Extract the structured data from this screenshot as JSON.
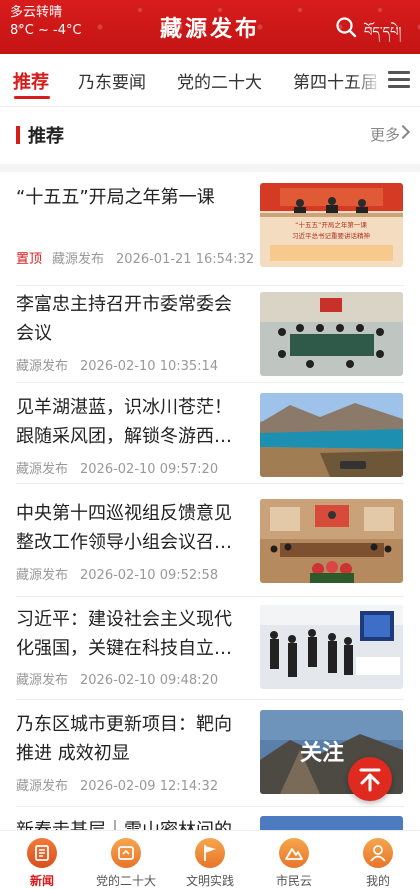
{
  "header": {
    "weather_condition": "多云转晴",
    "temperature_range": "8°C ~ -4°C",
    "app_title": "藏源发布",
    "tibetan_label": "བོད་དཔེ།",
    "search_icon": "search-icon"
  },
  "tabs": [
    {
      "label": "推荐",
      "active": true
    },
    {
      "label": "乃东要闻",
      "active": false
    },
    {
      "label": "党的二十大",
      "active": false
    },
    {
      "label": "第四十五届",
      "active": false
    }
  ],
  "section": {
    "title": "推荐",
    "more_label": "更多"
  },
  "news": [
    {
      "title": "“十五五”开局之年第一课",
      "pinned_label": "置顶",
      "source": "藏源发布",
      "time": "2026-01-21 16:54:32"
    },
    {
      "title": "李富忠主持召开市委常委会会议",
      "pinned_label": "",
      "source": "藏源发布",
      "time": "2026-02-10 10:35:14"
    },
    {
      "title": "见羊湖湛蓝，识冰川苍茫！跟随采风团，解锁冬游西…",
      "pinned_label": "",
      "source": "藏源发布",
      "time": "2026-02-10 09:57:20"
    },
    {
      "title": "中央第十四巡视组反馈意见整改工作领导小组会议召…",
      "pinned_label": "",
      "source": "藏源发布",
      "time": "2026-02-10 09:52:58"
    },
    {
      "title": "习近平：建设社会主义现代化强国，关键在科技自立…",
      "pinned_label": "",
      "source": "藏源发布",
      "time": "2026-02-10 09:48:20"
    },
    {
      "title": "乃东区城市更新项目：靶向推进 成效初显",
      "pinned_label": "",
      "source": "藏源发布",
      "time": "2026-02-09 12:14:32"
    },
    {
      "title": "新春走基层｜雪山密林间的",
      "pinned_label": "",
      "source": "",
      "time": ""
    }
  ],
  "thumb_texts": {
    "banner_line1": "“十五五”开局之年第一课",
    "banner_line2": "习近平总书记重要讲话精神",
    "guanzhu": "关注"
  },
  "bottom_nav": [
    {
      "label": "新闻",
      "active": true,
      "icon": "news-icon"
    },
    {
      "label": "党的二十大",
      "active": false,
      "icon": "party-icon"
    },
    {
      "label": "文明实践",
      "active": false,
      "icon": "flag-icon"
    },
    {
      "label": "市民云",
      "active": false,
      "icon": "mountain-icon"
    },
    {
      "label": "我的",
      "active": false,
      "icon": "user-icon"
    }
  ],
  "colors": {
    "brand_red": "#d81c1c",
    "nav_orange": "#e8752a"
  }
}
